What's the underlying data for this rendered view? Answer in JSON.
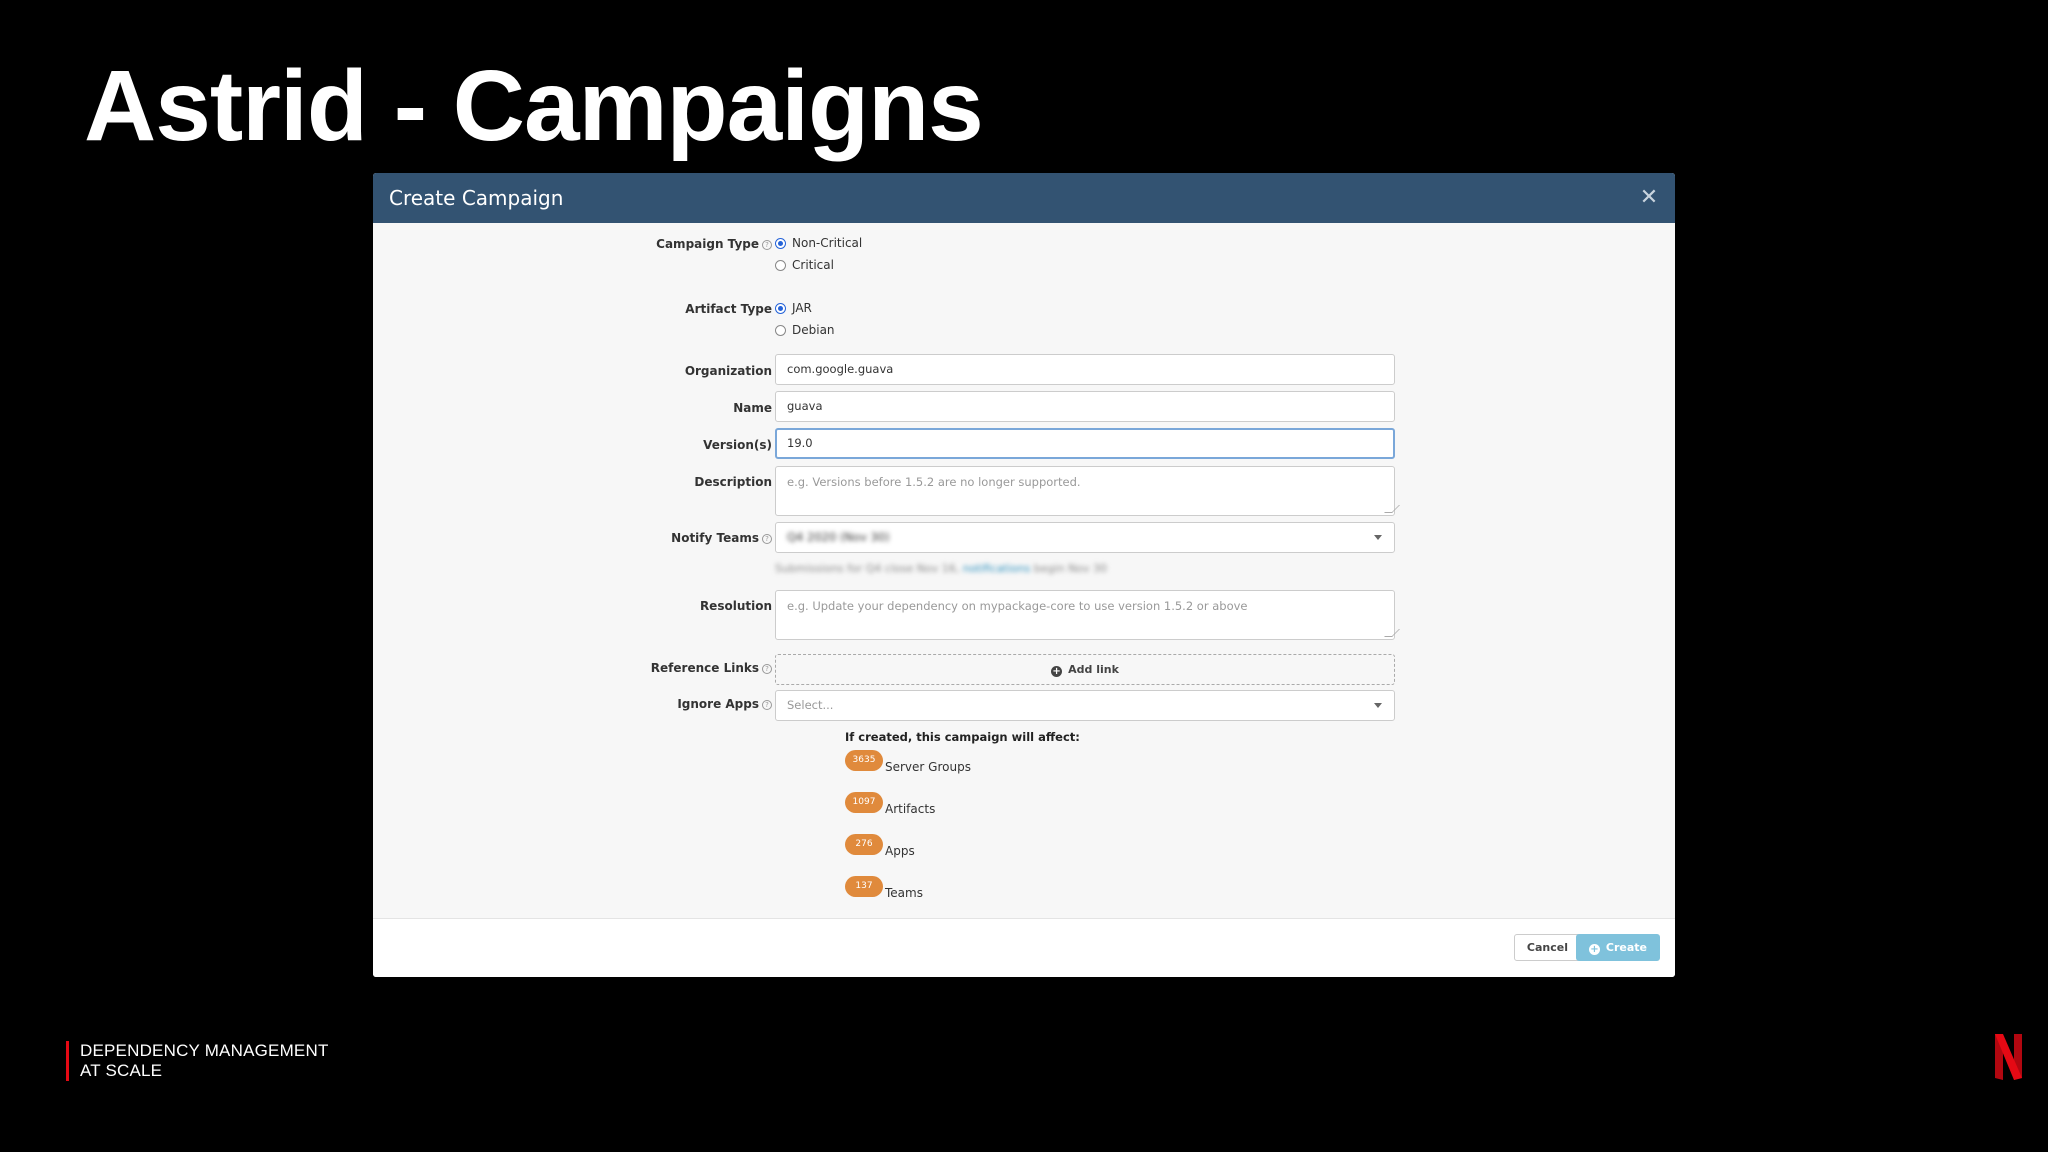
{
  "slide": {
    "title": "Astrid - Campaigns",
    "footer_line1": "DEPENDENCY MANAGEMENT",
    "footer_line2": "AT SCALE",
    "logo_icon": "netflix-n-logo",
    "accent_color": "#e50914"
  },
  "modal": {
    "title": "Create Campaign",
    "close_icon": "close-icon",
    "header_color": "#335372",
    "campaign_type": {
      "label": "Campaign Type",
      "options": [
        "Non-Critical",
        "Critical"
      ],
      "selected": "Non-Critical"
    },
    "artifact_type": {
      "label": "Artifact Type",
      "options": [
        "JAR",
        "Debian"
      ],
      "selected": "JAR"
    },
    "organization": {
      "label": "Organization",
      "value": "com.google.guava"
    },
    "name": {
      "label": "Name",
      "value": "guava"
    },
    "versions": {
      "label": "Version(s)",
      "value": "19.0"
    },
    "description": {
      "label": "Description",
      "placeholder": "e.g. Versions before 1.5.2 are no longer supported."
    },
    "notify_teams": {
      "label": "Notify Teams",
      "value": "Q4 2020 (Nov 30)",
      "hint_before": "Submissions for Q4 close Nov 16, ",
      "hint_link": "notifications",
      "hint_after": " begin Nov 30"
    },
    "resolution": {
      "label": "Resolution",
      "placeholder": "e.g. Update your dependency on mypackage-core to use version 1.5.2 or above"
    },
    "reference_links": {
      "label": "Reference Links",
      "button": "Add link"
    },
    "ignore_apps": {
      "label": "Ignore Apps",
      "placeholder": "Select..."
    },
    "affect": {
      "title": "If created, this campaign will affect:",
      "badge_color": "#e08a3c",
      "stats": [
        {
          "count": "3635",
          "label": "Server Groups"
        },
        {
          "count": "1097",
          "label": "Artifacts"
        },
        {
          "count": "276",
          "label": "Apps"
        },
        {
          "count": "137",
          "label": "Teams"
        }
      ]
    },
    "footer": {
      "cancel": "Cancel",
      "create": "Create"
    }
  }
}
